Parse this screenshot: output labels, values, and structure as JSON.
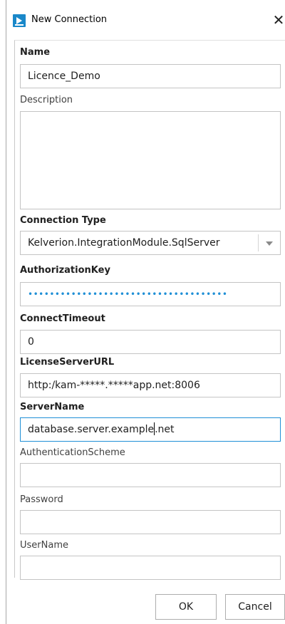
{
  "window": {
    "title": "New Connection"
  },
  "fields": {
    "name": {
      "label": "Name",
      "value": "Licence_Demo"
    },
    "description": {
      "label": "Description",
      "value": ""
    },
    "connection_type": {
      "label": "Connection Type",
      "value": "Kelverion.IntegrationModule.SqlServer"
    },
    "authorization_key": {
      "label": "AuthorizationKey",
      "value": "•••••••••••••••••••••••••••••••••••••"
    },
    "connect_timeout": {
      "label": "ConnectTimeout",
      "value": "0"
    },
    "license_server_url": {
      "label": "LicenseServerURL",
      "value": "http:/kam-*****.*****app.net:8006"
    },
    "server_name": {
      "label": "ServerName",
      "value_before_caret": "database.server.example",
      "value_after_caret": ".net"
    },
    "authentication_scheme": {
      "label": "AuthenticationScheme",
      "value": ""
    },
    "password": {
      "label": "Password",
      "value": ""
    },
    "username": {
      "label": "UserName",
      "value": ""
    }
  },
  "buttons": {
    "ok": "OK",
    "cancel": "Cancel"
  },
  "colors": {
    "accent": "#1f8fd6",
    "app_icon": "#1a88c9"
  }
}
